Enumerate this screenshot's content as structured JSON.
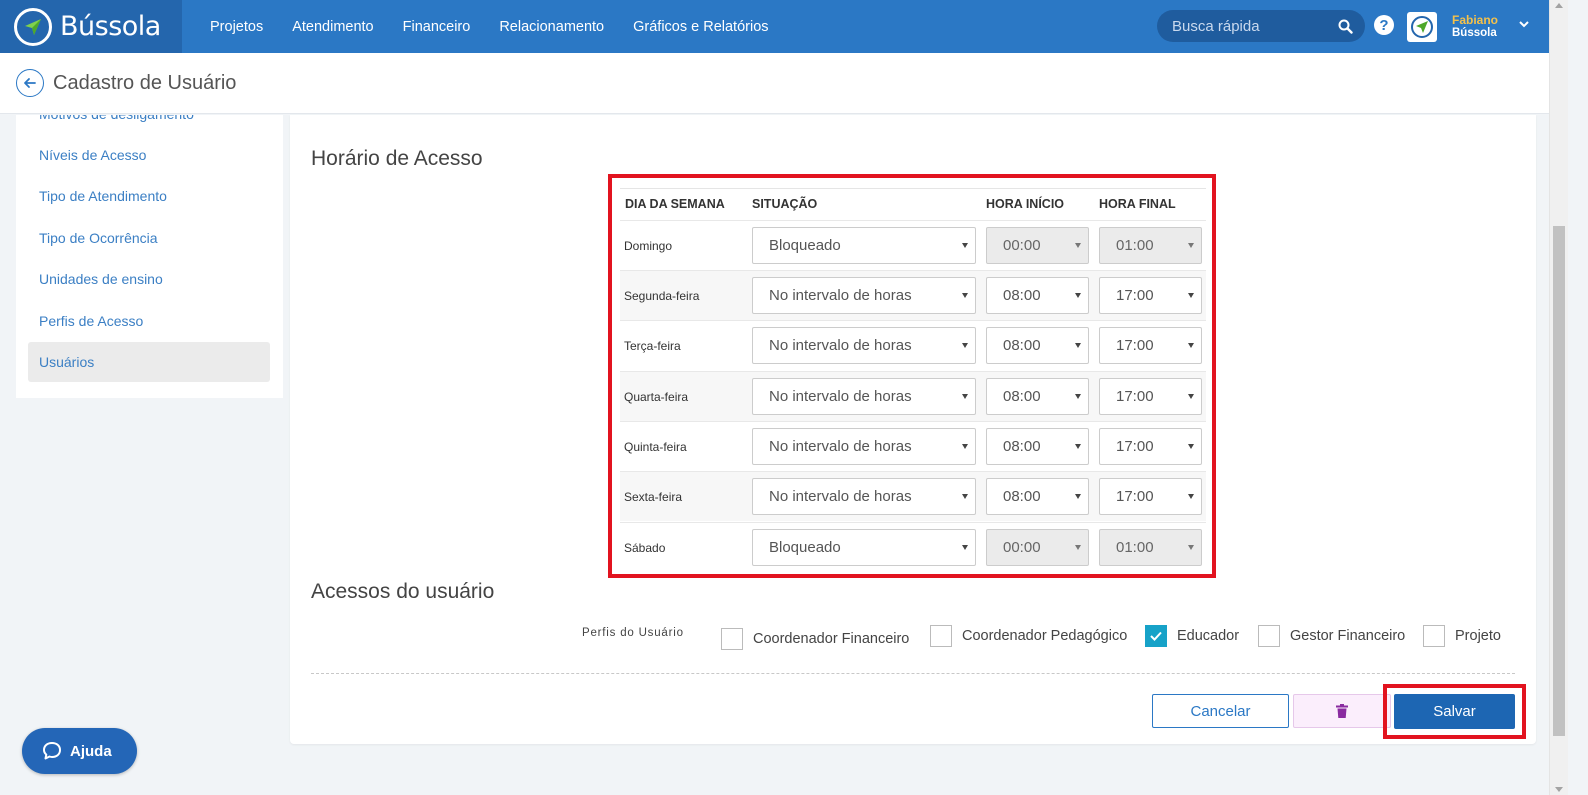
{
  "app": {
    "name": "Bússola"
  },
  "nav": [
    "Projetos",
    "Atendimento",
    "Financeiro",
    "Relacionamento",
    "Gráficos e Relatórios"
  ],
  "search": {
    "placeholder": "Busca rápida"
  },
  "user": {
    "name": "Fabiano",
    "org": "Bússola"
  },
  "page": {
    "title": "Cadastro de Usuário"
  },
  "sidebar": {
    "items": [
      {
        "label": "Motivos de desligamento"
      },
      {
        "label": "Níveis de Acesso"
      },
      {
        "label": "Tipo de Atendimento"
      },
      {
        "label": "Tipo de Ocorrência"
      },
      {
        "label": "Unidades de ensino"
      },
      {
        "label": "Perfis de Acesso"
      },
      {
        "label": "Usuários",
        "active": true
      }
    ]
  },
  "horario": {
    "title": "Horário de Acesso",
    "headers": {
      "day": "DIA DA SEMANA",
      "status": "SITUAÇÃO",
      "start": "HORA INÍCIO",
      "end": "HORA FINAL"
    },
    "rows": [
      {
        "day": "Domingo",
        "status": "Bloqueado",
        "start": "00:00",
        "end": "01:00",
        "disabled": true
      },
      {
        "day": "Segunda-feira",
        "status": "No intervalo de horas",
        "start": "08:00",
        "end": "17:00",
        "disabled": false
      },
      {
        "day": "Terça-feira",
        "status": "No intervalo de horas",
        "start": "08:00",
        "end": "17:00",
        "disabled": false
      },
      {
        "day": "Quarta-feira",
        "status": "No intervalo de horas",
        "start": "08:00",
        "end": "17:00",
        "disabled": false
      },
      {
        "day": "Quinta-feira",
        "status": "No intervalo de horas",
        "start": "08:00",
        "end": "17:00",
        "disabled": false
      },
      {
        "day": "Sexta-feira",
        "status": "No intervalo de horas",
        "start": "08:00",
        "end": "17:00",
        "disabled": false
      },
      {
        "day": "Sábado",
        "status": "Bloqueado",
        "start": "00:00",
        "end": "01:00",
        "disabled": true
      }
    ]
  },
  "acessos": {
    "title": "Acessos do usuário",
    "perfis_label": "Perfis do Usuário",
    "perfis": [
      {
        "label": "Coordenador Financeiro",
        "checked": false
      },
      {
        "label": "Coordenador Pedagógico",
        "checked": false
      },
      {
        "label": "Educador",
        "checked": true
      },
      {
        "label": "Gestor Financeiro",
        "checked": false
      },
      {
        "label": "Projeto",
        "checked": false
      }
    ]
  },
  "actions": {
    "cancel": "Cancelar",
    "save": "Salvar"
  },
  "help": {
    "label": "Ajuda"
  },
  "colors": {
    "brand": "#2b78c5",
    "brand_dark": "#2466ad",
    "highlight": "#e2131f",
    "check": "#17a2c8",
    "save": "#1d66b3"
  },
  "icons": [
    "compass-logo-icon",
    "search-icon",
    "help-icon",
    "avatar-logo-icon",
    "chevron-down-icon",
    "back-arrow-icon",
    "trash-icon",
    "chat-icon"
  ]
}
